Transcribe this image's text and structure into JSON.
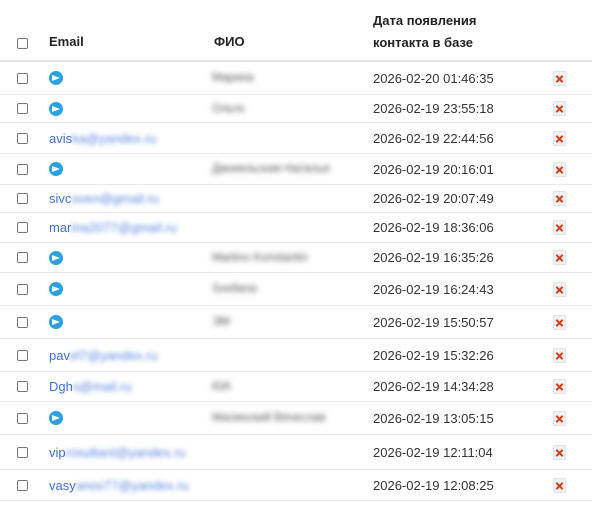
{
  "header": {
    "email": "Email",
    "fio": "ФИО",
    "date_line1": "Дата появления",
    "date_line2": "контакта в базе"
  },
  "icons": {
    "telegram": "telegram-icon",
    "delete": "delete-icon"
  },
  "colors": {
    "link": "#3d6fd6",
    "telegram": "#2aa3e0",
    "delete": "#d63a1e"
  },
  "rows": [
    {
      "type": "tg",
      "email_visible": "",
      "email_hidden": "",
      "fio": "Марина",
      "date": "2026-02-20 01:46:35"
    },
    {
      "type": "tg",
      "email_visible": "",
      "email_hidden": "",
      "fio": "Ольга",
      "date": "2026-02-19 23:55:18"
    },
    {
      "type": "email",
      "email_visible": "avis",
      "email_hidden": "ka@yandex.ru",
      "fio": "",
      "date": "2026-02-19 22:44:56"
    },
    {
      "type": "tg",
      "email_visible": "",
      "email_hidden": "",
      "fio": "Даниельская Наталья",
      "date": "2026-02-19 20:16:01"
    },
    {
      "type": "email",
      "email_visible": "sivc",
      "email_hidden": "oven@gmail.ru",
      "fio": "",
      "date": "2026-02-19 20:07:49"
    },
    {
      "type": "email",
      "email_visible": "mar",
      "email_hidden": "ina2077@gmail.ru",
      "fio": "",
      "date": "2026-02-19 18:36:06"
    },
    {
      "type": "tg",
      "email_visible": "",
      "email_hidden": "",
      "fio": "Martino Konstantin",
      "date": "2026-02-19 16:35:26"
    },
    {
      "type": "tg",
      "email_visible": "",
      "email_hidden": "",
      "fio": "Svetlana",
      "date": "2026-02-19 16:24:43"
    },
    {
      "type": "tg",
      "email_visible": "",
      "email_hidden": "",
      "fio": "ЭМ",
      "date": "2026-02-19 15:50:57"
    },
    {
      "type": "email",
      "email_visible": "pav",
      "email_hidden": "el7@yandex.ru",
      "fio": "",
      "date": "2026-02-19 15:32:26"
    },
    {
      "type": "email",
      "email_visible": "Dgh",
      "email_hidden": "s@mail.ru",
      "fio": "ЮА",
      "date": "2026-02-19 14:34:28"
    },
    {
      "type": "tg",
      "email_visible": "",
      "email_hidden": "",
      "fio": "Малинский Вячеслав",
      "date": "2026-02-19 13:05:15"
    },
    {
      "type": "email",
      "email_visible": "vip",
      "email_hidden": "rosultant@yandex.ru",
      "fio": "",
      "date": "2026-02-19 12:11:04"
    },
    {
      "type": "email",
      "email_visible": "vasy",
      "email_hidden": "anov77@yandex.ru",
      "fio": "",
      "date": "2026-02-19 12:08:25"
    }
  ]
}
